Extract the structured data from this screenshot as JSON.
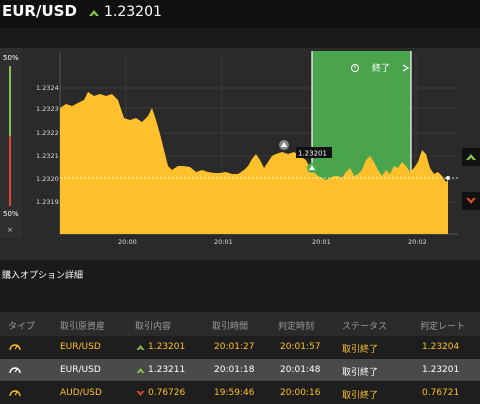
{
  "header": {
    "pair": "EUR/USD",
    "rate": "1.23201"
  },
  "percent": {
    "top": "50%",
    "bottom": "50%"
  },
  "close_symbol": "×",
  "chart": {
    "y_ticks": [
      "1.2324",
      "1.2323",
      "1.2322",
      "1.2321",
      "1.2320",
      "1.2319"
    ],
    "x_ticks": [
      "20:00",
      "20:01",
      "20:01",
      "20:02"
    ],
    "end_label": "終了",
    "marker_label": "1.23201",
    "colors": {
      "area": "#ffc02b",
      "end_zone": "#4caf50",
      "up": "#8bc34a",
      "down": "#e0492f"
    }
  },
  "section_title": "購入オプション詳細",
  "table": {
    "headers": [
      "タイプ",
      "取引原資産",
      "取引内容",
      "取引時間",
      "判定時刻",
      "ステータス",
      "判定レート"
    ],
    "rows": [
      {
        "asset": "EUR/USD",
        "direction": "up",
        "price": "1.23201",
        "trade_time": "20:01:27",
        "judge_time": "20:01:57",
        "status": "取引終了",
        "judge_rate": "1.23204"
      },
      {
        "asset": "EUR/USD",
        "direction": "up",
        "price": "1.23211",
        "trade_time": "20:01:18",
        "judge_time": "20:01:48",
        "status": "取引終了",
        "judge_rate": "1.23201"
      },
      {
        "asset": "AUD/USD",
        "direction": "down",
        "price": "0.76726",
        "trade_time": "19:59:46",
        "judge_time": "20:00:16",
        "status": "取引終了",
        "judge_rate": "0.76721"
      }
    ]
  }
}
